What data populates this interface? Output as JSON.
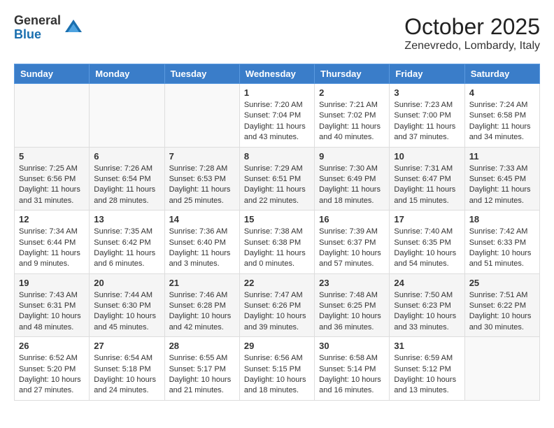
{
  "header": {
    "logo_general": "General",
    "logo_blue": "Blue",
    "month_title": "October 2025",
    "location": "Zenevredo, Lombardy, Italy"
  },
  "days_of_week": [
    "Sunday",
    "Monday",
    "Tuesday",
    "Wednesday",
    "Thursday",
    "Friday",
    "Saturday"
  ],
  "weeks": [
    [
      {
        "day": "",
        "info": ""
      },
      {
        "day": "",
        "info": ""
      },
      {
        "day": "",
        "info": ""
      },
      {
        "day": "1",
        "info": "Sunrise: 7:20 AM\nSunset: 7:04 PM\nDaylight: 11 hours and 43 minutes."
      },
      {
        "day": "2",
        "info": "Sunrise: 7:21 AM\nSunset: 7:02 PM\nDaylight: 11 hours and 40 minutes."
      },
      {
        "day": "3",
        "info": "Sunrise: 7:23 AM\nSunset: 7:00 PM\nDaylight: 11 hours and 37 minutes."
      },
      {
        "day": "4",
        "info": "Sunrise: 7:24 AM\nSunset: 6:58 PM\nDaylight: 11 hours and 34 minutes."
      }
    ],
    [
      {
        "day": "5",
        "info": "Sunrise: 7:25 AM\nSunset: 6:56 PM\nDaylight: 11 hours and 31 minutes."
      },
      {
        "day": "6",
        "info": "Sunrise: 7:26 AM\nSunset: 6:54 PM\nDaylight: 11 hours and 28 minutes."
      },
      {
        "day": "7",
        "info": "Sunrise: 7:28 AM\nSunset: 6:53 PM\nDaylight: 11 hours and 25 minutes."
      },
      {
        "day": "8",
        "info": "Sunrise: 7:29 AM\nSunset: 6:51 PM\nDaylight: 11 hours and 22 minutes."
      },
      {
        "day": "9",
        "info": "Sunrise: 7:30 AM\nSunset: 6:49 PM\nDaylight: 11 hours and 18 minutes."
      },
      {
        "day": "10",
        "info": "Sunrise: 7:31 AM\nSunset: 6:47 PM\nDaylight: 11 hours and 15 minutes."
      },
      {
        "day": "11",
        "info": "Sunrise: 7:33 AM\nSunset: 6:45 PM\nDaylight: 11 hours and 12 minutes."
      }
    ],
    [
      {
        "day": "12",
        "info": "Sunrise: 7:34 AM\nSunset: 6:44 PM\nDaylight: 11 hours and 9 minutes."
      },
      {
        "day": "13",
        "info": "Sunrise: 7:35 AM\nSunset: 6:42 PM\nDaylight: 11 hours and 6 minutes."
      },
      {
        "day": "14",
        "info": "Sunrise: 7:36 AM\nSunset: 6:40 PM\nDaylight: 11 hours and 3 minutes."
      },
      {
        "day": "15",
        "info": "Sunrise: 7:38 AM\nSunset: 6:38 PM\nDaylight: 11 hours and 0 minutes."
      },
      {
        "day": "16",
        "info": "Sunrise: 7:39 AM\nSunset: 6:37 PM\nDaylight: 10 hours and 57 minutes."
      },
      {
        "day": "17",
        "info": "Sunrise: 7:40 AM\nSunset: 6:35 PM\nDaylight: 10 hours and 54 minutes."
      },
      {
        "day": "18",
        "info": "Sunrise: 7:42 AM\nSunset: 6:33 PM\nDaylight: 10 hours and 51 minutes."
      }
    ],
    [
      {
        "day": "19",
        "info": "Sunrise: 7:43 AM\nSunset: 6:31 PM\nDaylight: 10 hours and 48 minutes."
      },
      {
        "day": "20",
        "info": "Sunrise: 7:44 AM\nSunset: 6:30 PM\nDaylight: 10 hours and 45 minutes."
      },
      {
        "day": "21",
        "info": "Sunrise: 7:46 AM\nSunset: 6:28 PM\nDaylight: 10 hours and 42 minutes."
      },
      {
        "day": "22",
        "info": "Sunrise: 7:47 AM\nSunset: 6:26 PM\nDaylight: 10 hours and 39 minutes."
      },
      {
        "day": "23",
        "info": "Sunrise: 7:48 AM\nSunset: 6:25 PM\nDaylight: 10 hours and 36 minutes."
      },
      {
        "day": "24",
        "info": "Sunrise: 7:50 AM\nSunset: 6:23 PM\nDaylight: 10 hours and 33 minutes."
      },
      {
        "day": "25",
        "info": "Sunrise: 7:51 AM\nSunset: 6:22 PM\nDaylight: 10 hours and 30 minutes."
      }
    ],
    [
      {
        "day": "26",
        "info": "Sunrise: 6:52 AM\nSunset: 5:20 PM\nDaylight: 10 hours and 27 minutes."
      },
      {
        "day": "27",
        "info": "Sunrise: 6:54 AM\nSunset: 5:18 PM\nDaylight: 10 hours and 24 minutes."
      },
      {
        "day": "28",
        "info": "Sunrise: 6:55 AM\nSunset: 5:17 PM\nDaylight: 10 hours and 21 minutes."
      },
      {
        "day": "29",
        "info": "Sunrise: 6:56 AM\nSunset: 5:15 PM\nDaylight: 10 hours and 18 minutes."
      },
      {
        "day": "30",
        "info": "Sunrise: 6:58 AM\nSunset: 5:14 PM\nDaylight: 10 hours and 16 minutes."
      },
      {
        "day": "31",
        "info": "Sunrise: 6:59 AM\nSunset: 5:12 PM\nDaylight: 10 hours and 13 minutes."
      },
      {
        "day": "",
        "info": ""
      }
    ]
  ]
}
